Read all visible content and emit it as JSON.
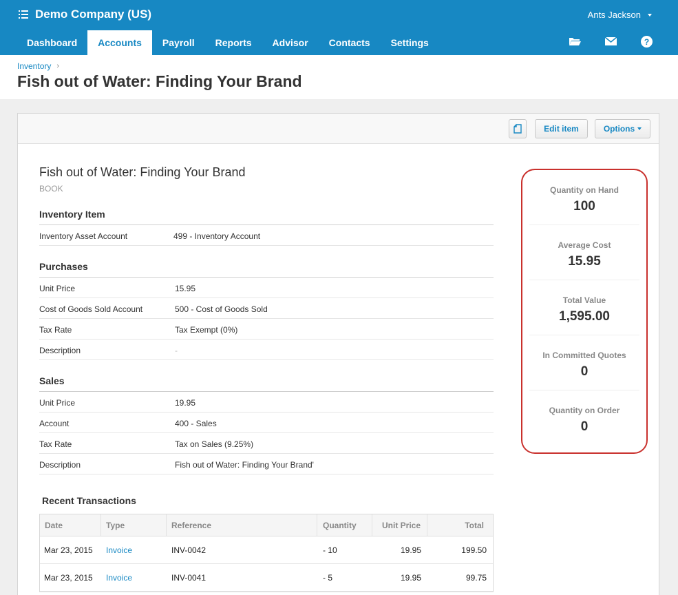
{
  "org": {
    "name": "Demo Company (US)",
    "menu_icon": "list-icon"
  },
  "user": {
    "name": "Ants Jackson"
  },
  "nav": {
    "tabs": [
      "Dashboard",
      "Accounts",
      "Payroll",
      "Reports",
      "Advisor",
      "Contacts",
      "Settings"
    ],
    "active": "Accounts",
    "icons": [
      "folder-icon",
      "mail-icon",
      "help-icon"
    ]
  },
  "breadcrumb": {
    "parent": "Inventory",
    "separator": "›"
  },
  "page": {
    "title": "Fish out of Water: Finding Your Brand"
  },
  "toolbar": {
    "edit_label": "Edit item",
    "options_label": "Options",
    "copy_icon": "copy-icon"
  },
  "item": {
    "name": "Fish out of Water: Finding Your Brand",
    "type": "BOOK",
    "inventory": {
      "heading": "Inventory Item",
      "rows": [
        {
          "label": "Inventory Asset Account",
          "value": "499 - Inventory Account"
        }
      ]
    },
    "purchases": {
      "heading": "Purchases",
      "rows": [
        {
          "label": "Unit Price",
          "value": "15.95"
        },
        {
          "label": "Cost of Goods Sold Account",
          "value": "500 - Cost of Goods Sold"
        },
        {
          "label": "Tax Rate",
          "value": "Tax Exempt (0%)"
        },
        {
          "label": "Description",
          "value": "-"
        }
      ]
    },
    "sales": {
      "heading": "Sales",
      "rows": [
        {
          "label": "Unit Price",
          "value": "19.95"
        },
        {
          "label": "Account",
          "value": "400 - Sales"
        },
        {
          "label": "Tax Rate",
          "value": "Tax on Sales (9.25%)"
        },
        {
          "label": "Description",
          "value": "Fish out of Water: Finding Your Brand'"
        }
      ]
    }
  },
  "stats": [
    {
      "label": "Quantity on Hand",
      "value": "100"
    },
    {
      "label": "Average Cost",
      "value": "15.95"
    },
    {
      "label": "Total Value",
      "value": "1,595.00"
    },
    {
      "label": "In Committed Quotes",
      "value": "0"
    },
    {
      "label": "Quantity on Order",
      "value": "0"
    }
  ],
  "transactions": {
    "heading": "Recent Transactions",
    "columns": [
      "Date",
      "Type",
      "Reference",
      "Quantity",
      "Unit Price",
      "Total"
    ],
    "rows": [
      [
        "Mar 23, 2015",
        "Invoice",
        "INV-0042",
        "- 10",
        "19.95",
        "199.50"
      ],
      [
        "Mar 23, 2015",
        "Invoice",
        "INV-0041",
        "- 5",
        "19.95",
        "99.75"
      ]
    ]
  },
  "colors": {
    "brand": "#1788c3",
    "highlight": "#c9302c"
  }
}
